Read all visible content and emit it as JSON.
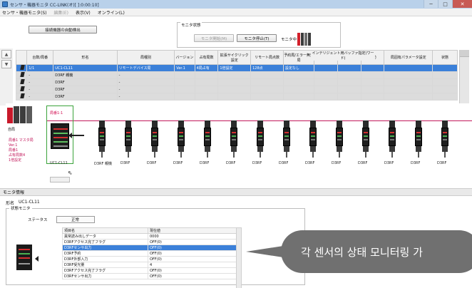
{
  "window": {
    "title": "センサ・機器モニタ CC-LINK(オ)[ ]:0:00:10]",
    "controls": [
      "─",
      "□",
      "✕"
    ]
  },
  "menu": {
    "items": [
      {
        "label": "センサ・機器モニタ(S)",
        "enabled": true
      },
      {
        "label": "編集(E)",
        "enabled": false
      },
      {
        "label": "表示(V)",
        "enabled": true
      },
      {
        "label": "オンライン(L)",
        "enabled": true
      }
    ]
  },
  "toolbar": {
    "auto_detect_label": "接続機器の自動検出",
    "monitor_status_label": "モニタ状態",
    "monitor_start_label": "モニタ開始(M)",
    "monitor_stop_label": "モニタ停止(T)",
    "monitor_state": "モニタ中"
  },
  "grid": {
    "headers": [
      "",
      "台数/局番",
      "形名",
      "局種別",
      "バージョン",
      "占有局数",
      "拡張サイクリック設定",
      "リモート局点数",
      "予約局/エラー無効局",
      "送信",
      "受信",
      "自動",
      "局固有パラメータ設定",
      "状態"
    ],
    "group_header": "インテリジェント用バッファ指定(ワード)",
    "rows": [
      {
        "selected": true,
        "cells": [
          "1/1",
          "UC1-CL11",
          "リモートデバイス局",
          "Ver.1",
          "4局占有",
          "1倍設定",
          "128点",
          "設定なし",
          "",
          "",
          "",
          "",
          ""
        ]
      },
      {
        "selected": false,
        "cells": [
          "-",
          "D3RF 親機",
          "-",
          "",
          "",
          "",
          "",
          "",
          "",
          "",
          "",
          "",
          ""
        ]
      },
      {
        "selected": false,
        "cells": [
          "-",
          "D3RF",
          "-",
          "",
          "",
          "",
          "",
          "",
          "",
          "",
          "",
          "",
          ""
        ]
      },
      {
        "selected": false,
        "cells": [
          "-",
          "D3RF",
          "-",
          "",
          "",
          "",
          "",
          "",
          "",
          "",
          "",
          "",
          ""
        ]
      },
      {
        "selected": false,
        "cells": [
          "-",
          "D3RF",
          "-",
          "",
          "",
          "",
          "",
          "",
          "",
          "",
          "",
          "",
          ""
        ]
      }
    ]
  },
  "topology": {
    "host_label": "自局",
    "node_tag": "局番1-1",
    "master_info": [
      "局番1 マスタ局",
      "Ver.1",
      "局番1",
      "占有局数4",
      "1倍設定"
    ],
    "nodes": [
      "UC1-CL11",
      "D3RF 親機",
      "D3RF",
      "D3RF",
      "D3RF",
      "D3RF",
      "D3RF",
      "D3RF",
      "D3RF",
      "D3RF",
      "D3RF",
      "D3RF",
      "D3RF",
      "D3RF",
      "D3RF"
    ]
  },
  "monitor_panel": {
    "title": "モニタ情報",
    "model_label": "形名",
    "model_value": "UC1-CL11",
    "state_group": "状態モニタ",
    "status_label": "ステータス",
    "status_value": "正常",
    "columns": [
      "項目名",
      "現在値"
    ],
    "rows": [
      {
        "name": "異常読み出しデータ",
        "value": "0000",
        "hl": false
      },
      {
        "name": "D3RFアクセス完了フラグ",
        "value": "OFF(0)",
        "hl": false
      },
      {
        "name": "D3RFセンサ出力",
        "value": "OFF(0)",
        "hl": true
      },
      {
        "name": "D3RF予約",
        "value": "OFF(0)",
        "hl": false
      },
      {
        "name": "D3RF外部入力",
        "value": "OFF(0)",
        "hl": false
      },
      {
        "name": "D3RF受光量",
        "value": "4",
        "hl": false
      },
      {
        "name": "D3RFアクセス完了フラグ",
        "value": "OFF(0)",
        "hl": false
      },
      {
        "name": "D3RFセンサ出力",
        "value": "OFF(0)",
        "hl": false
      }
    ]
  },
  "callout": {
    "text": "각 센서의 상태 모니터링 가"
  },
  "colors": {
    "selection": "#3b80d9",
    "topology_line": "#c2185b",
    "highlight_frame": "#3aa33a",
    "callout_bg": "#707070"
  }
}
